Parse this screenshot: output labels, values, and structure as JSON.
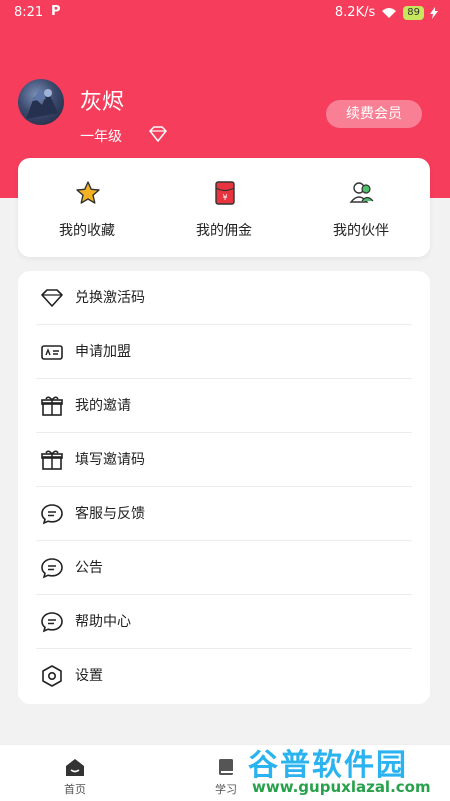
{
  "status_bar": {
    "time": "8:21",
    "app_mark": "P",
    "speed": "8.2K/s",
    "battery": "89"
  },
  "profile": {
    "name": "灰烬",
    "grade": "一年级",
    "renew_label": "续费会员"
  },
  "stats": [
    {
      "label": "我的收藏",
      "icon": "star-icon"
    },
    {
      "label": "我的佣金",
      "icon": "red-envelope-icon"
    },
    {
      "label": "我的伙伴",
      "icon": "partners-icon"
    }
  ],
  "menu": [
    {
      "label": "兑换激活码",
      "icon": "diamond-icon"
    },
    {
      "label": "申请加盟",
      "icon": "id-card-icon"
    },
    {
      "label": "我的邀请",
      "icon": "gift-icon"
    },
    {
      "label": "填写邀请码",
      "icon": "gift-icon"
    },
    {
      "label": "客服与反馈",
      "icon": "chat-icon"
    },
    {
      "label": "公告",
      "icon": "chat-icon"
    },
    {
      "label": "帮助中心",
      "icon": "chat-icon"
    },
    {
      "label": "设置",
      "icon": "hexagon-settings-icon"
    }
  ],
  "bottom_nav": [
    {
      "label": "首页",
      "icon": "home-icon"
    },
    {
      "label": "学习",
      "icon": "book-icon"
    }
  ],
  "watermark": {
    "title": "谷普软件园",
    "url": "www.gupuxlazal.com"
  },
  "colors": {
    "header": "#f63d5b",
    "star": "#f5b324",
    "envelope": "#e8343f"
  }
}
